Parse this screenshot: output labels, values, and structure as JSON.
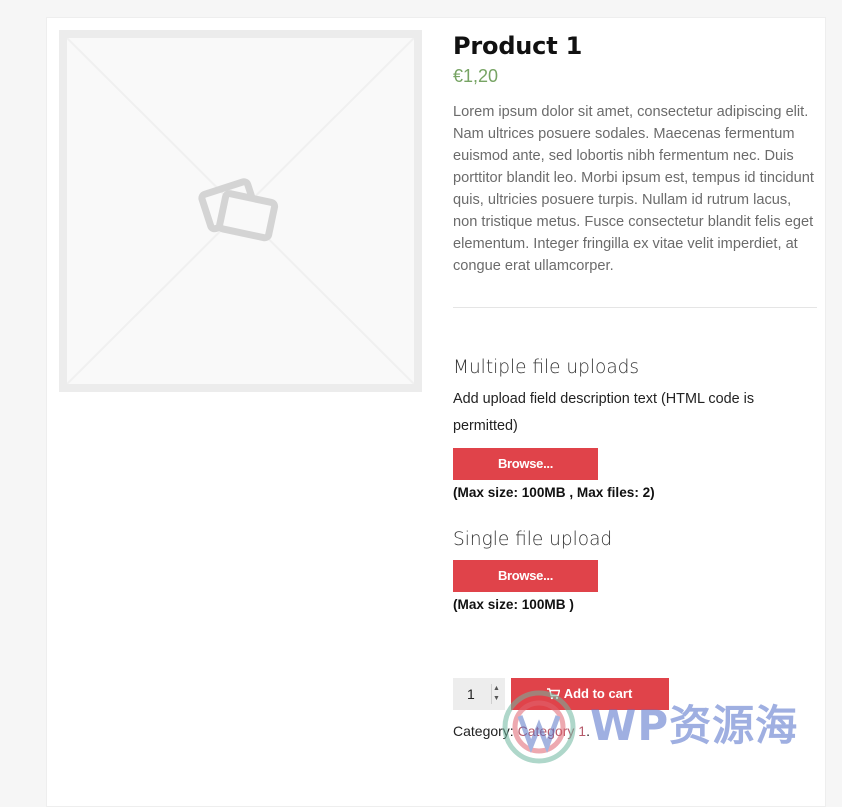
{
  "product": {
    "title": "Product 1",
    "price": "€1,20",
    "description": "Lorem ipsum dolor sit amet, consectetur adipiscing elit. Nam ultrices posuere sodales. Maecenas fermentum euismod ante, sed lobortis nibh fermentum nec. Duis porttitor blandit leo. Morbi ipsum est, tempus id tincidunt quis, ultricies posuere turpis. Nullam id rutrum lacus, non tristique metus. Fusce consectetur blandit felis eget elementum. Integer fringilla ex vitae velit imperdiet, at congue erat ullamcorper."
  },
  "uploads": {
    "multiple": {
      "heading": "Multiple file uploads",
      "description": "Add upload field description text (HTML code is permitted)",
      "browse_label": "Browse...",
      "limits": "(Max size: 100MB , Max files: 2)"
    },
    "single": {
      "heading": "Single file upload",
      "browse_label": "Browse...",
      "limits": "(Max size: 100MB )"
    }
  },
  "cart": {
    "quantity": "1",
    "add_to_cart_label": "Add to cart"
  },
  "meta": {
    "category_label": "Category:",
    "category_link": "Category 1",
    "category_suffix": "."
  },
  "watermark": {
    "text": "WP资源海"
  },
  "colors": {
    "accent": "#e0434a",
    "price": "#77a464",
    "link": "#b65a6a"
  },
  "icons": {
    "image_placeholder": "image-placeholder-icon",
    "cart": "cart-icon",
    "spinner": "spinner-arrows-icon"
  }
}
